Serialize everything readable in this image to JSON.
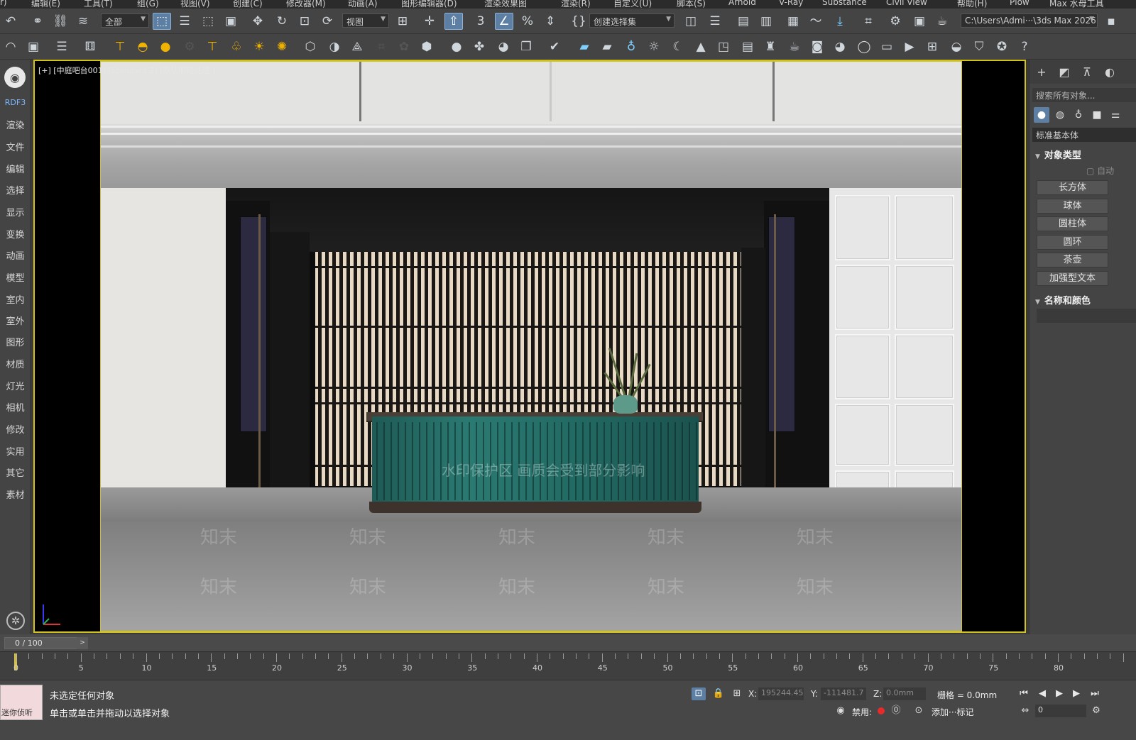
{
  "menubar": {
    "items": [
      "r)",
      "编辑(E)",
      "工具(T)",
      "组(G)",
      "视图(V)",
      "创建(C)",
      "修改器(M)",
      "动画(A)",
      "图形编辑器(D)",
      "渲染效果图",
      "渲染(R)",
      "自定义(U)",
      "脚本(S)",
      "Arnold",
      "V-Ray",
      "Substance",
      "Civil View",
      "帮助(H)",
      "Plow",
      "Max 水母工具"
    ]
  },
  "toolbar1": {
    "selection_filter": "全部",
    "reference_coord": "视图",
    "named_selection": "创建选择集",
    "project_path": "C:\\Users\\Admi···\\3ds Max 2026"
  },
  "left_strip": {
    "items": [
      "RDF3",
      "渲染",
      "文件",
      "编辑",
      "选择",
      "显示",
      "变换",
      "动画",
      "模型",
      "室内",
      "室外",
      "图形",
      "材质",
      "灯光",
      "相机",
      "修改",
      "实用",
      "其它",
      "素材"
    ]
  },
  "viewport": {
    "label": "[+] [中庭吧台001] [Standard 2] [默认明暗处理 ]",
    "watermark_notice": "水印保护区  画质会受到部分影响",
    "watermark_text": "知末"
  },
  "command_panel": {
    "search_placeholder": "搜索所有对象...",
    "category": "标准基本体",
    "object_type_header": "对象类型",
    "autogrid_label": "自动",
    "buttons": [
      "长方体",
      "球体",
      "圆柱体",
      "圆环",
      "茶壶",
      "加强型文本"
    ],
    "name_color_header": "名称和颜色"
  },
  "timeline": {
    "frame_display": "0 / 100",
    "current_frame": 0,
    "range": [
      0,
      100
    ],
    "labels": [
      "0",
      "5",
      "10",
      "15",
      "20",
      "25",
      "30",
      "35",
      "40",
      "45",
      "50",
      "55",
      "60",
      "65",
      "70",
      "75",
      "80"
    ]
  },
  "statusbar": {
    "maxscript_text": "迷你侦听",
    "selection_status": "未选定任何对象",
    "prompt": "单击或单击并拖动以选择对象",
    "x_label": "X:",
    "x_value": "195244.45",
    "y_label": "Y:",
    "y_value": "-111481.7",
    "z_label": "Z:",
    "z_value": "0.0mm",
    "grid_label": "栅格 = 0.0mm",
    "disabled_label": "禁用:",
    "add_marker_label": "添加···标记",
    "frame_spinner": "0"
  },
  "colors": {
    "viewport_border": "#d4c21c",
    "active_button": "#5c7fa3",
    "counter_teal": "#2b7a72",
    "record_red": "#e82a2a"
  },
  "icons": {
    "toolbar1": [
      "undo-icon",
      "link-icon",
      "unlink-icon",
      "bind-spacewarp-icon",
      "select-object-icon",
      "select-by-name-icon",
      "rect-selection-icon",
      "window-crossing-icon",
      "move-icon",
      "rotate-icon",
      "scale-icon",
      "placement-icon",
      "pivot-icon",
      "manipulate-icon",
      "snap-3d-icon",
      "angle-snap-icon",
      "percent-snap-icon",
      "spinner-snap-icon",
      "edit-named-sets-icon",
      "mirror-icon",
      "align-icon",
      "scene-explorer-icon",
      "layer-icon",
      "curve-editor-icon",
      "schematic-icon",
      "material-editor-icon",
      "render-setup-icon",
      "render-frame-icon",
      "render-icon"
    ],
    "toolbar2": [
      "vray-light-icon",
      "proxy-icon",
      "list-icon",
      "camera-rig-icon",
      "lamp-icon",
      "dome-icon",
      "sun-icon",
      "sphere-icon",
      "flame-icon",
      "gear-icon",
      "box-icon",
      "globe-icon",
      "clay-icon",
      "grid-icon",
      "plant-icon",
      "texture-icon",
      "material-ball-icon",
      "flower-icon",
      "cube-icon",
      "vray-icon",
      "help-icon"
    ]
  }
}
